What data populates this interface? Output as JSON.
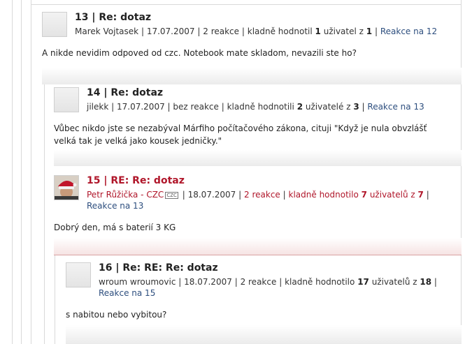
{
  "comments": [
    {
      "number": "13",
      "title": "Re: dotaz",
      "author": "Marek Vojtasek",
      "date": "17.07.2007",
      "reactions": "2 reakce",
      "rating_prefix": "kladně hodnotil",
      "rating_count": "1",
      "rating_mid": "uživatel z",
      "rating_total": "1",
      "reply_link": "Reakce na 12",
      "text": "A nikde nevidim odpoved od czc. Notebook mate skladom, nevazili ste ho?"
    },
    {
      "number": "14",
      "title": "Re: dotaz",
      "author": "jilekk",
      "date": "17.07.2007",
      "reactions": "bez reakce",
      "rating_prefix": "kladně hodnotili",
      "rating_count": "2",
      "rating_mid": "uživatelé z",
      "rating_total": "3",
      "reply_link": "Reakce na 13",
      "text": "Vůbec nikdo jste se nezabýval Márfiho počítačového zákona, cituji \"Když je nula obvzlášť velká tak je velká jako kousek jedničky.\""
    },
    {
      "number": "15",
      "title": "RE: Re: dotaz",
      "author": "Petr Růžička - CZC",
      "author_badge": "CZC",
      "date": "18.07.2007",
      "reactions": "2 reakce",
      "rating_prefix": "kladně hodnotilo",
      "rating_count": "7",
      "rating_mid": "uživatelů z",
      "rating_total": "7",
      "reply_link": "Reakce na 13",
      "text": "Dobrý den, má s baterií 3 KG",
      "accent_color": "#b0162a"
    },
    {
      "number": "16",
      "title": "Re: RE: Re: dotaz",
      "author": "wroum wroumovic",
      "date": "18.07.2007",
      "reactions": "2 reakce",
      "rating_prefix": "kladně hodnotilo",
      "rating_count": "17",
      "rating_mid": "uživatelů z",
      "rating_total": "18",
      "reply_link": "Reakce na 15",
      "text": "s nabitou nebo vybitou?"
    }
  ],
  "separator": "|"
}
